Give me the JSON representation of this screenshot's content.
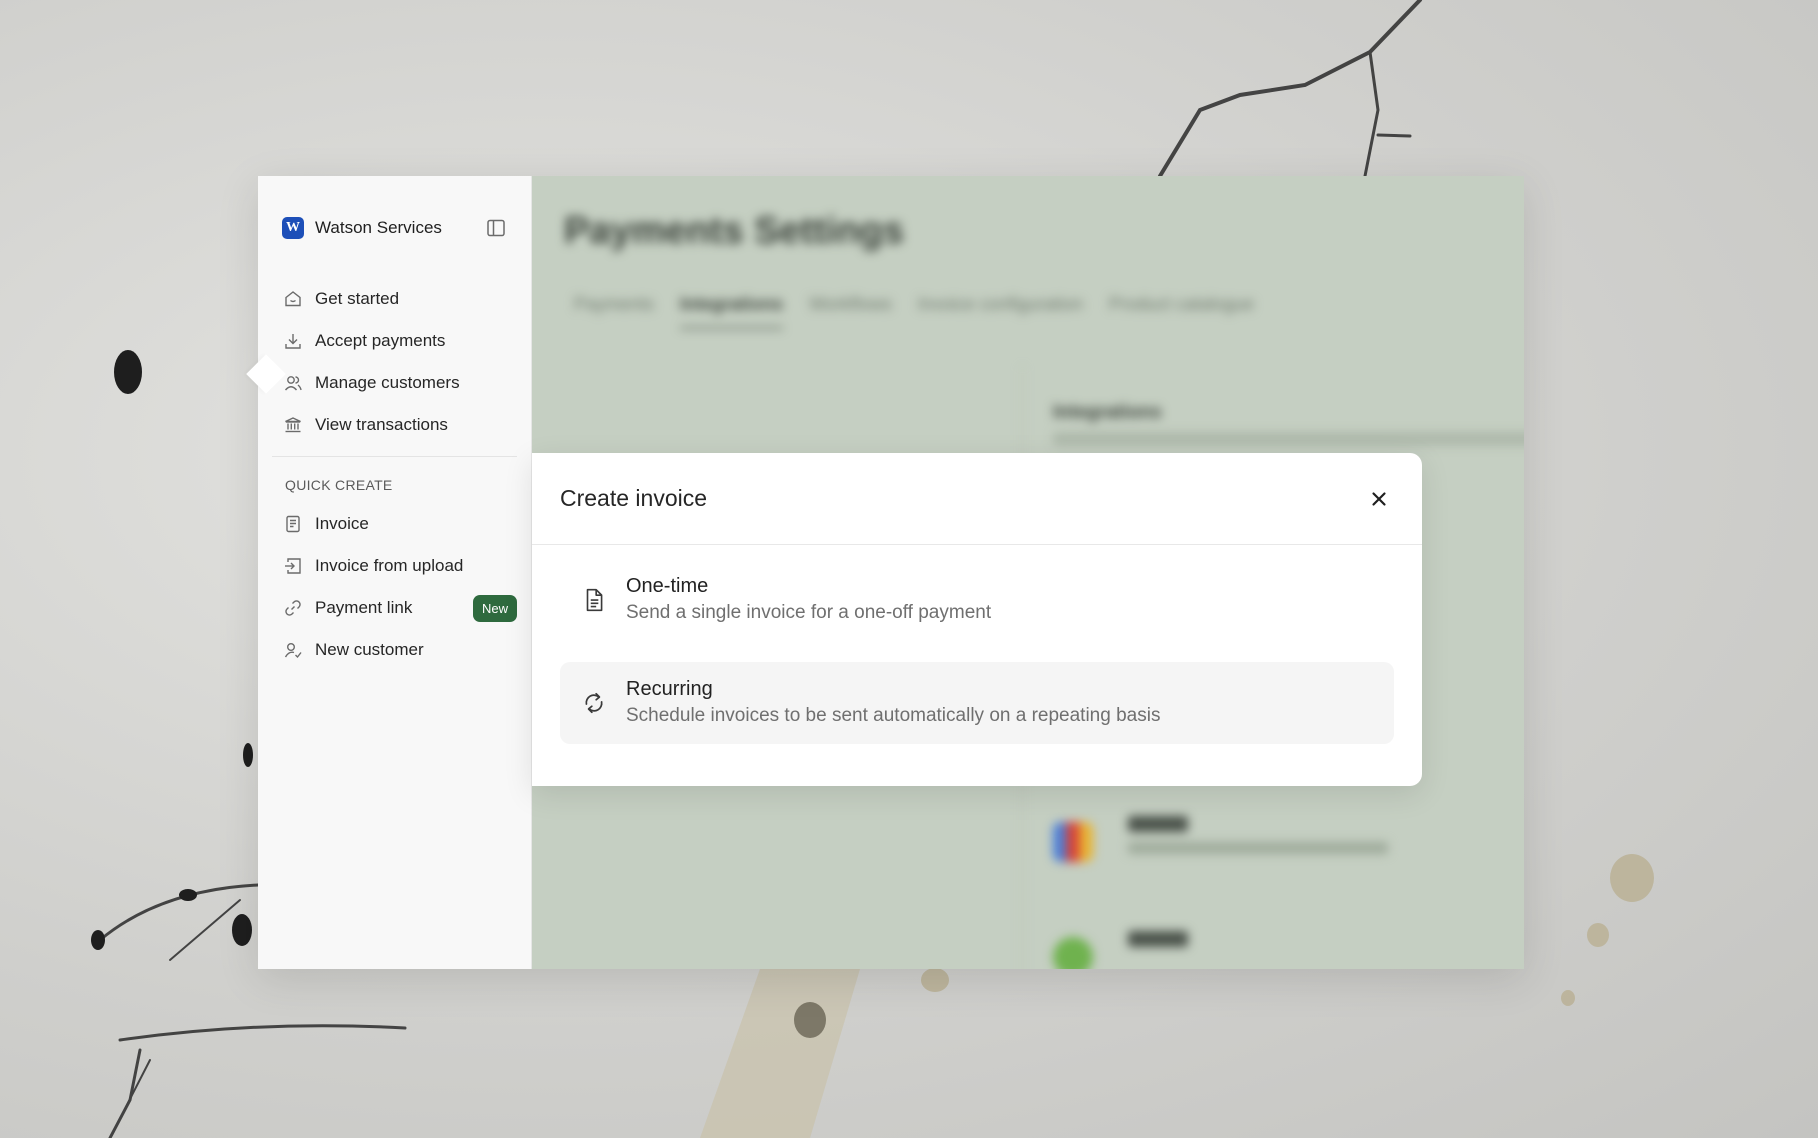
{
  "app": {
    "brand": {
      "initial": "W",
      "name": "Watson Services",
      "color": "#1d4fb8"
    }
  },
  "sidebar": {
    "nav": [
      {
        "label": "Get started",
        "icon": "home-icon"
      },
      {
        "label": "Accept payments",
        "icon": "download-icon"
      },
      {
        "label": "Manage customers",
        "icon": "users-icon"
      },
      {
        "label": "View transactions",
        "icon": "bank-icon"
      }
    ],
    "section_title": "QUICK CREATE",
    "quick_create": [
      {
        "label": "Invoice",
        "icon": "invoice-icon"
      },
      {
        "label": "Invoice from upload",
        "icon": "upload-icon"
      },
      {
        "label": "Payment link",
        "icon": "link-icon",
        "badge": "New"
      },
      {
        "label": "New customer",
        "icon": "user-check-icon"
      }
    ]
  },
  "background_page": {
    "title": "Payments Settings",
    "tabs": [
      "Payments",
      "Integrations",
      "Workflows",
      "Invoice configuration",
      "Product catalogue"
    ],
    "active_tab": "Integrations",
    "section_heading": "Integrations",
    "integrations": [
      "Gmail",
      "Actionstep"
    ]
  },
  "modal": {
    "title": "Create invoice",
    "options": [
      {
        "title": "One-time",
        "description": "Send a single invoice for a one-off payment",
        "icon": "document-icon"
      },
      {
        "title": "Recurring",
        "description": "Schedule invoices to be sent automatically on a repeating basis",
        "icon": "refresh-icon"
      }
    ]
  },
  "colors": {
    "badge": "#2e6a3e",
    "main_bg": "#c5cfc2"
  }
}
